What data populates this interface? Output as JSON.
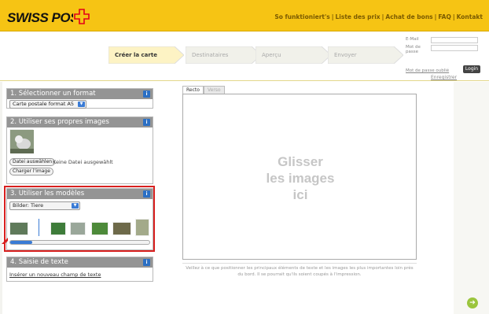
{
  "header": {
    "brand": "SWISS POST",
    "nav": [
      "So funktioniert's",
      "Liste des prix",
      "Achat de bons",
      "FAQ",
      "Kontakt"
    ],
    "nav_sep": "|"
  },
  "steps": [
    {
      "label": "Créer la carte"
    },
    {
      "label": "Destinataires"
    },
    {
      "label": "Aperçu"
    },
    {
      "label": "Envoyer"
    }
  ],
  "login": {
    "email_label": "E-Mail",
    "password_label": "Mot de passe",
    "lost_password": "Mot de passe oublié",
    "login_button": "Login",
    "register": "Enregistrer"
  },
  "panels": {
    "format": {
      "title": "1. Sélectionner un format",
      "selected": "Carte postale format A5",
      "info": "i"
    },
    "images": {
      "title": "2. Utiliser ses propres images",
      "choose_file": "Datei auswählen",
      "no_file": "Keine Datei ausgewählt",
      "upload": "Charger l'image",
      "info": "i"
    },
    "templates": {
      "title": "3. Utiliser les modèles",
      "selected": "Bilder: Tiere",
      "info": "i"
    },
    "text": {
      "title": "4. Saisie de texte",
      "insert_link": "Insérer un nouveau champ de texte",
      "info": "i"
    }
  },
  "editor": {
    "tabs": [
      "Recto",
      "Verso"
    ],
    "drop_line1": "Glisser",
    "drop_line2": "les images",
    "drop_line3": "ici",
    "note_line1": "Veillez à ce que positionner les principaux éléments de texte et les images les plus importantes loin près",
    "note_line2": "du bord. Il se pourrait qu'ils soient coupés à l'impression."
  },
  "colors": {
    "brand_yellow": "#f6c414",
    "panel_header": "#949494",
    "highlight_red": "#d8201f",
    "info_blue": "#2b6fc4",
    "next_green": "#9bc53d"
  },
  "icons": {
    "info": "info-icon",
    "dropdown": "chevron-down-icon",
    "next": "arrow-right-icon",
    "cross": "swiss-cross-logo"
  }
}
